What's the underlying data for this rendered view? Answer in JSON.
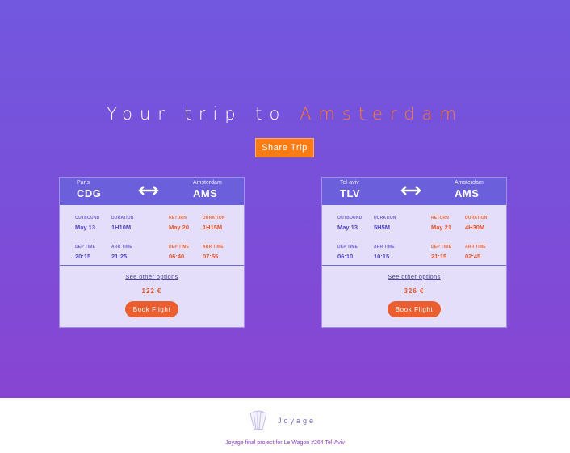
{
  "hero": {
    "title_prefix": "Your trip to",
    "title_city": "Amsterdam",
    "share_label": "Share Trip"
  },
  "cards": [
    {
      "from_city": "Paris",
      "from_code": "CDG",
      "to_city": "Amsterdam",
      "to_code": "AMS",
      "outbound": {
        "outbound_label": "OUTBOUND",
        "date": "May 13",
        "duration_label": "DURATION",
        "duration": "1H10M",
        "dep_label": "DEP TIME",
        "dep": "20:15",
        "arr_label": "ARR TIME",
        "arr": "21:25"
      },
      "return": {
        "return_label": "RETURN",
        "date": "May 20",
        "duration_label": "DURATION",
        "duration": "1H15M",
        "dep_label": "DEP TIME",
        "dep": "06:40",
        "arr_label": "ARR TIME",
        "arr": "07:55"
      },
      "other_options": "See other options",
      "price": "122 €",
      "book_label": "Book Flight"
    },
    {
      "from_city": "Tel-aviv",
      "from_code": "TLV",
      "to_city": "Amsterdam",
      "to_code": "AMS",
      "outbound": {
        "outbound_label": "OUTBOUND",
        "date": "May 13",
        "duration_label": "DURATION",
        "duration": "5H5M",
        "dep_label": "DEP TIME",
        "dep": "06:10",
        "arr_label": "ARR TIME",
        "arr": "10:15"
      },
      "return": {
        "return_label": "RETURN",
        "date": "May 21",
        "duration_label": "DURATION",
        "duration": "4H30M",
        "dep_label": "DEP TIME",
        "dep": "21:15",
        "arr_label": "ARR TIME",
        "arr": "02:45"
      },
      "other_options": "See other options",
      "price": "326 €",
      "book_label": "Book Flight"
    }
  ],
  "footer": {
    "brand": "Joyage",
    "credit": "Joyage final project for Le Wagon #264 Tel-Aviv",
    "logo_icon": "fan-cards-logo-icon"
  },
  "colors": {
    "accent_orange": "#ff7b14",
    "card_header": "#6b5fdb",
    "card_body": "#e5defa",
    "return_text": "#e4572e",
    "outbound_text": "#4f47c4"
  }
}
